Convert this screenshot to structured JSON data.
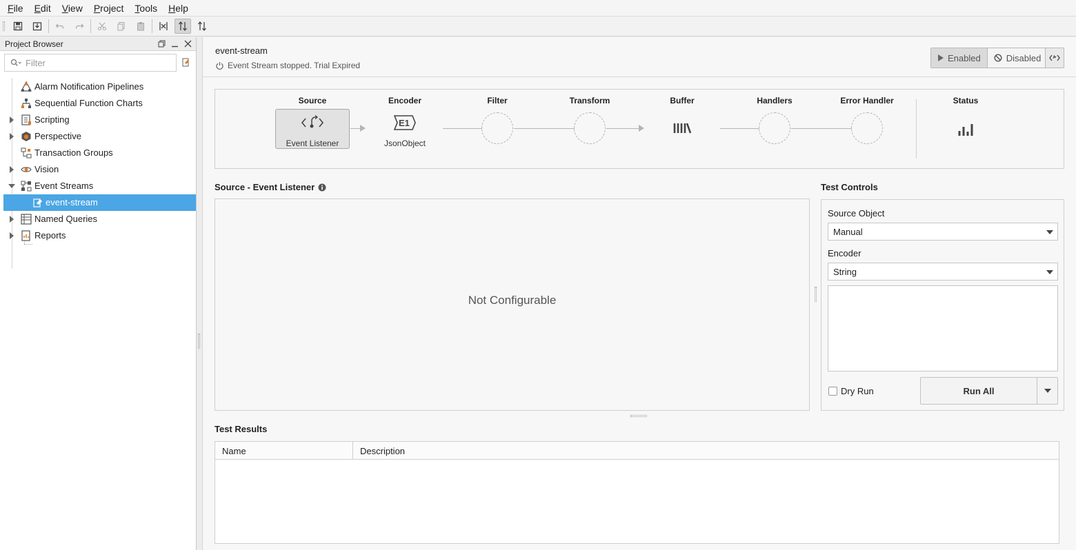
{
  "menu": {
    "items": [
      {
        "key": "F",
        "rest": "ile"
      },
      {
        "key": "E",
        "rest": "dit"
      },
      {
        "key": "V",
        "rest": "iew"
      },
      {
        "key": "P",
        "rest": "roject"
      },
      {
        "key": "T",
        "rest": "ools"
      },
      {
        "key": "H",
        "rest": "elp"
      }
    ]
  },
  "project_browser": {
    "title": "Project Browser",
    "filter_placeholder": "Filter",
    "items": [
      {
        "label": "Alarm Notification Pipelines",
        "icon": "alarm-pipeline-icon"
      },
      {
        "label": "Sequential Function Charts",
        "icon": "sfc-icon"
      },
      {
        "label": "Scripting",
        "icon": "scripting-icon"
      },
      {
        "label": "Perspective",
        "icon": "perspective-icon"
      },
      {
        "label": "Transaction Groups",
        "icon": "transaction-groups-icon"
      },
      {
        "label": "Vision",
        "icon": "vision-icon"
      },
      {
        "label": "Event Streams",
        "icon": "event-streams-icon"
      },
      {
        "label": "event-stream",
        "icon": "event-stream-icon",
        "selected": true
      },
      {
        "label": "Named Queries",
        "icon": "named-queries-icon"
      },
      {
        "label": "Reports",
        "icon": "reports-icon"
      }
    ]
  },
  "editor": {
    "title": "event-stream",
    "status": "Event Stream stopped. Trial Expired",
    "enabled_label": "Enabled",
    "disabled_label": "Disabled"
  },
  "pipeline": {
    "source": {
      "title": "Source",
      "sub": "Event Listener"
    },
    "encoder": {
      "title": "Encoder",
      "sub": "JsonObject"
    },
    "filter": {
      "title": "Filter"
    },
    "transform": {
      "title": "Transform"
    },
    "buffer": {
      "title": "Buffer"
    },
    "handlers": {
      "title": "Handlers"
    },
    "error_handler": {
      "title": "Error Handler"
    },
    "status": {
      "title": "Status"
    }
  },
  "source_section": {
    "title": "Source - Event Listener",
    "message": "Not Configurable"
  },
  "test_controls": {
    "title": "Test Controls",
    "source_object_label": "Source Object",
    "source_object_value": "Manual",
    "encoder_label": "Encoder",
    "encoder_value": "String",
    "dry_run_label": "Dry Run",
    "run_all_label": "Run All"
  },
  "test_results": {
    "title": "Test Results",
    "columns": [
      "Name",
      "Description"
    ]
  },
  "colors": {
    "selection": "#4aa6e4",
    "accent_orange": "#e07b1e"
  }
}
